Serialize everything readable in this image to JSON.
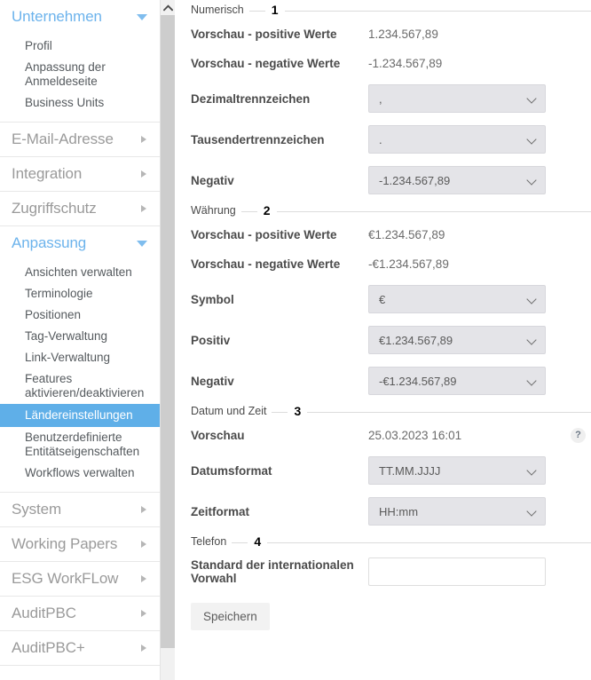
{
  "sidebar": {
    "groups": [
      {
        "label": "Unternehmen",
        "expanded": true,
        "children": [
          {
            "label": "Profil",
            "selected": false
          },
          {
            "label": "Anpassung der Anmeldeseite",
            "selected": false
          },
          {
            "label": "Business Units",
            "selected": false
          }
        ]
      },
      {
        "label": "E-Mail-Adresse",
        "expanded": false,
        "children": []
      },
      {
        "label": "Integration",
        "expanded": false,
        "children": []
      },
      {
        "label": "Zugriffschutz",
        "expanded": false,
        "children": []
      },
      {
        "label": "Anpassung",
        "expanded": true,
        "children": [
          {
            "label": "Ansichten verwalten",
            "selected": false
          },
          {
            "label": "Terminologie",
            "selected": false
          },
          {
            "label": "Positionen",
            "selected": false
          },
          {
            "label": "Tag-Verwaltung",
            "selected": false
          },
          {
            "label": "Link-Verwaltung",
            "selected": false
          },
          {
            "label": "Features aktivieren/deaktivieren",
            "selected": false
          },
          {
            "label": "Ländereinstellungen",
            "selected": true
          },
          {
            "label": "Benutzerdefinierte Entitätseigenschaften",
            "selected": false
          },
          {
            "label": "Workflows verwalten",
            "selected": false
          }
        ]
      },
      {
        "label": "System",
        "expanded": false,
        "children": []
      },
      {
        "label": "Working Papers",
        "expanded": false,
        "children": []
      },
      {
        "label": "ESG WorkFLow",
        "expanded": false,
        "children": []
      },
      {
        "label": "AuditPBC",
        "expanded": false,
        "children": []
      },
      {
        "label": "AuditPBC+",
        "expanded": false,
        "children": []
      }
    ],
    "scrollbar": {
      "up_arrow": "chevron-up-icon"
    },
    "accent_color": "#5fafe8",
    "selected_text_color": "#ffffff"
  },
  "main": {
    "sections": [
      {
        "title": "Numerisch",
        "number": "1",
        "preview_rows": [
          {
            "label": "Vorschau - positive Werte",
            "value": "1.234.567,89"
          },
          {
            "label": "Vorschau - negative Werte",
            "value": "-1.234.567,89"
          }
        ],
        "select_rows": [
          {
            "label": "Dezimaltrennzeichen",
            "value": ","
          },
          {
            "label": "Tausendertrennzeichen",
            "value": "."
          },
          {
            "label": "Negativ",
            "value": "-1.234.567,89"
          }
        ]
      },
      {
        "title": "Währung",
        "number": "2",
        "preview_rows": [
          {
            "label": "Vorschau - positive Werte",
            "value": "€1.234.567,89"
          },
          {
            "label": "Vorschau - negative Werte",
            "value": "-€1.234.567,89"
          }
        ],
        "select_rows": [
          {
            "label": "Symbol",
            "value": "€"
          },
          {
            "label": "Positiv",
            "value": "€1.234.567,89"
          },
          {
            "label": "Negativ",
            "value": "-€1.234.567,89"
          }
        ]
      },
      {
        "title": "Datum und Zeit",
        "number": "3",
        "preview_rows": [
          {
            "label": "Vorschau",
            "value": "25.03.2023 16:01",
            "help": "?"
          }
        ],
        "select_rows": [
          {
            "label": "Datumsformat",
            "value": "TT.MM.JJJJ"
          },
          {
            "label": "Zeitformat",
            "value": "HH:mm"
          }
        ]
      },
      {
        "title": "Telefon",
        "number": "4",
        "input_rows": [
          {
            "label": "Standard der internationalen Vorwahl",
            "value": "",
            "placeholder": ""
          }
        ]
      }
    ],
    "save_label": "Speichern"
  }
}
